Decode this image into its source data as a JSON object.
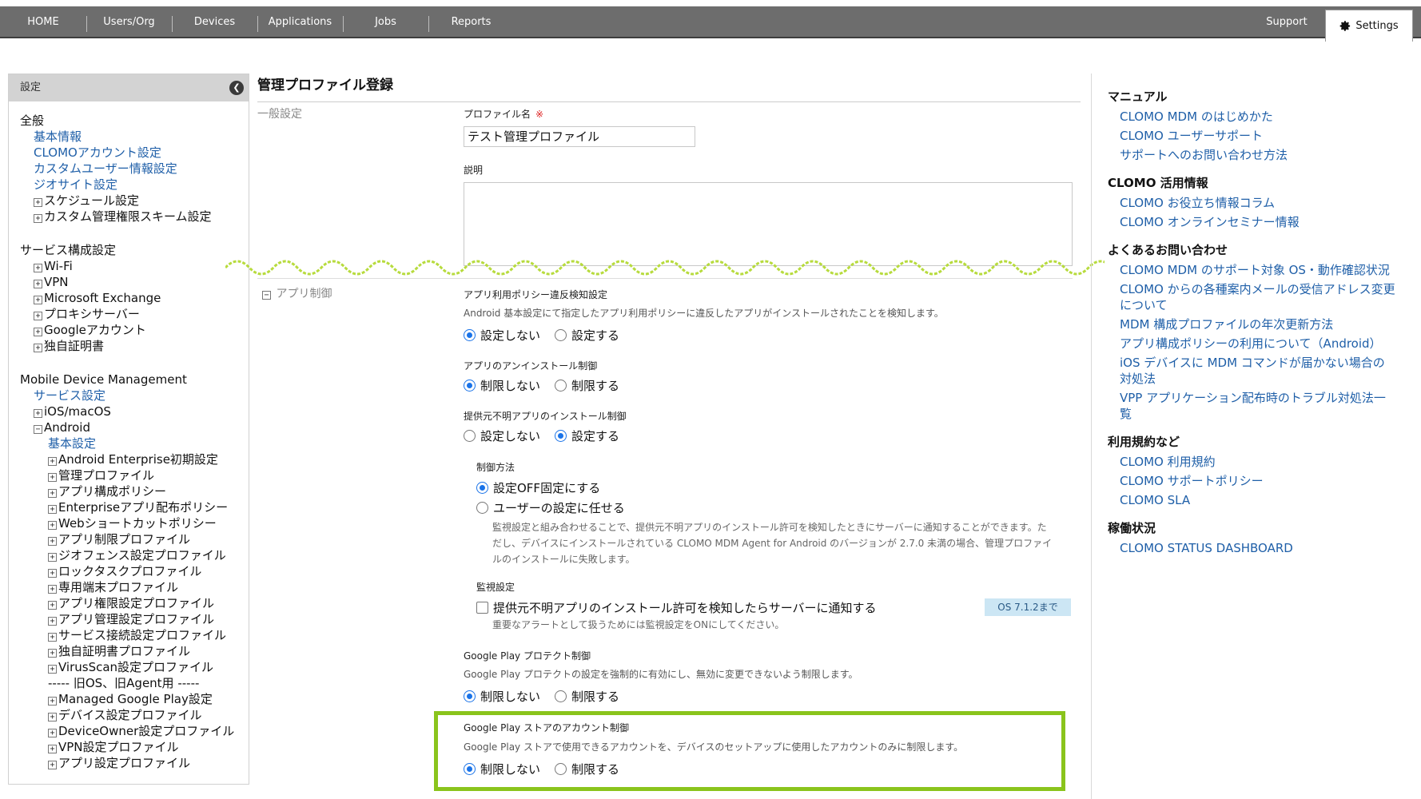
{
  "nav": {
    "items": [
      "HOME",
      "Users/Org",
      "Devices",
      "Applications",
      "Jobs",
      "Reports"
    ],
    "support": "Support",
    "settings": "Settings"
  },
  "sidebar": {
    "header": "設定",
    "collapse_glyph": "❮",
    "lines": [
      {
        "t": "全般",
        "k": "sec",
        "ind": 0
      },
      {
        "t": "基本情報",
        "k": "link",
        "ind": 1
      },
      {
        "t": "CLOMOアカウント設定",
        "k": "link",
        "ind": 1
      },
      {
        "t": "カスタムユーザー情報設定",
        "k": "link",
        "ind": 1
      },
      {
        "t": "ジオサイト設定",
        "k": "link",
        "ind": 1
      },
      {
        "t": "スケジュール設定",
        "k": "node",
        "ind": 1,
        "pm": "+"
      },
      {
        "t": "カスタム管理権限スキーム設定",
        "k": "node",
        "ind": 1,
        "pm": "+"
      },
      {
        "t": "サービス構成設定",
        "k": "sec",
        "ind": 0,
        "gap": true
      },
      {
        "t": "Wi-Fi",
        "k": "node",
        "ind": 1,
        "pm": "+"
      },
      {
        "t": "VPN",
        "k": "node",
        "ind": 1,
        "pm": "+"
      },
      {
        "t": "Microsoft Exchange",
        "k": "node",
        "ind": 1,
        "pm": "+"
      },
      {
        "t": "プロキシサーバー",
        "k": "node",
        "ind": 1,
        "pm": "+"
      },
      {
        "t": "Googleアカウント",
        "k": "node",
        "ind": 1,
        "pm": "+"
      },
      {
        "t": "独自証明書",
        "k": "node",
        "ind": 1,
        "pm": "+"
      },
      {
        "t": "Mobile Device Management",
        "k": "sec",
        "ind": 0,
        "gap": true
      },
      {
        "t": "サービス設定",
        "k": "link",
        "ind": 1
      },
      {
        "t": "iOS/macOS",
        "k": "node",
        "ind": 1,
        "pm": "+"
      },
      {
        "t": "Android",
        "k": "node",
        "ind": 1,
        "pm": "−"
      },
      {
        "t": "基本設定",
        "k": "link",
        "ind": 2
      },
      {
        "t": "Android Enterprise初期設定",
        "k": "node",
        "ind": 2,
        "pm": "+"
      },
      {
        "t": "管理プロファイル",
        "k": "node",
        "ind": 2,
        "pm": "+"
      },
      {
        "t": "アプリ構成ポリシー",
        "k": "node",
        "ind": 2,
        "pm": "+"
      },
      {
        "t": "Enterpriseアプリ配布ポリシー",
        "k": "node",
        "ind": 2,
        "pm": "+"
      },
      {
        "t": "Webショートカットポリシー",
        "k": "node",
        "ind": 2,
        "pm": "+"
      },
      {
        "t": "アプリ制限プロファイル",
        "k": "node",
        "ind": 2,
        "pm": "+"
      },
      {
        "t": "ジオフェンス設定プロファイル",
        "k": "node",
        "ind": 2,
        "pm": "+"
      },
      {
        "t": "ロックタスクプロファイル",
        "k": "node",
        "ind": 2,
        "pm": "+"
      },
      {
        "t": "専用端末プロファイル",
        "k": "node",
        "ind": 2,
        "pm": "+"
      },
      {
        "t": "アプリ権限設定プロファイル",
        "k": "node",
        "ind": 2,
        "pm": "+"
      },
      {
        "t": "アプリ管理設定プロファイル",
        "k": "node",
        "ind": 2,
        "pm": "+"
      },
      {
        "t": "サービス接続設定プロファイル",
        "k": "node",
        "ind": 2,
        "pm": "+"
      },
      {
        "t": "独自証明書プロファイル",
        "k": "node",
        "ind": 2,
        "pm": "+"
      },
      {
        "t": "VirusScan設定プロファイル",
        "k": "node",
        "ind": 2,
        "pm": "+"
      },
      {
        "t": "----- 旧OS、旧Agent用 -----",
        "k": "sec",
        "ind": 2
      },
      {
        "t": "Managed Google Play設定",
        "k": "node",
        "ind": 2,
        "pm": "+"
      },
      {
        "t": "デバイス設定プロファイル",
        "k": "node",
        "ind": 2,
        "pm": "+"
      },
      {
        "t": "DeviceOwner設定プロファイル",
        "k": "node",
        "ind": 2,
        "pm": "+"
      },
      {
        "t": "VPN設定プロファイル",
        "k": "node",
        "ind": 2,
        "pm": "+"
      },
      {
        "t": "アプリ設定プロファイル",
        "k": "node",
        "ind": 2,
        "pm": "+"
      }
    ]
  },
  "main": {
    "title": "管理プロファイル登録",
    "general_label": "一般設定",
    "profile_name_label": "プロファイル名",
    "required_mark": "※",
    "profile_name_value": "テスト管理プロファイル",
    "description_label": "説明",
    "app_control_label": "アプリ制御",
    "app_control_pm": "−",
    "policy_violation": {
      "title": "アプリ利用ポリシー違反検知設定",
      "desc": "Android 基本設定にて指定したアプリ利用ポリシーに違反したアプリがインストールされたことを検知します。",
      "opt1": "設定しない",
      "opt2": "設定する"
    },
    "uninstall": {
      "title": "アプリのアンインストール制御",
      "opt1": "制限しない",
      "opt2": "制限する"
    },
    "unknown_install": {
      "title": "提供元不明アプリのインストール制御",
      "opt1": "設定しない",
      "opt2": "設定する"
    },
    "control_method": {
      "title": "制御方法",
      "opt1": "設定OFF固定にする",
      "opt2": "ユーザーの設定に任せる",
      "note_line1": "監視設定と組み合わせることで、提供元不明アプリのインストール許可を検知したときにサーバーに通知することができます。た",
      "note_line2": "だし、デバイスにインストールされている CLOMO MDM Agent for Android のバージョンが 2.7.0 未満の場合、管理プロファイ",
      "note_line3": "ルのインストールに失敗します。"
    },
    "monitor": {
      "title": "監視設定",
      "checkbox": "提供元不明アプリのインストール許可を検知したらサーバーに通知する",
      "badge": "OS 7.1.2まで",
      "note": "重要なアラートとして扱うためには監視設定をONにしてください。"
    },
    "play_protect": {
      "title": "Google Play プロテクト制御",
      "desc": "Google Play プロテクトの設定を強制的に有効にし、無効に変更できないよう制限します。",
      "opt1": "制限しない",
      "opt2": "制限する"
    },
    "play_account": {
      "title": "Google Play ストアのアカウント制御",
      "desc": "Google Play ストアで使用できるアカウントを、デバイスのセットアップに使用したアカウントのみに制限します。",
      "opt1": "制限しない",
      "opt2": "制限する"
    }
  },
  "right": {
    "sections": [
      {
        "h": "マニュアル",
        "links": [
          "CLOMO MDM のはじめかた",
          "CLOMO ユーザーサポート",
          "サポートへのお問い合わせ方法"
        ]
      },
      {
        "h": "CLOMO 活用情報",
        "links": [
          "CLOMO お役立ち情報コラム",
          "CLOMO オンラインセミナー情報"
        ]
      },
      {
        "h": "よくあるお問い合わせ",
        "links": [
          "CLOMO MDM のサポート対象 OS・動作確認状況",
          "CLOMO からの各種案内メールの受信アドレス変更について",
          "MDM 構成プロファイルの年次更新方法",
          "アプリ構成ポリシーの利用について（Android）",
          "iOS デバイスに MDM コマンドが届かない場合の対処法",
          "VPP アプリケーション配布時のトラブル対処法一覧"
        ]
      },
      {
        "h": "利用規約など",
        "links": [
          "CLOMO 利用規約",
          "CLOMO サポートポリシー",
          "CLOMO SLA"
        ]
      },
      {
        "h": "稼働状況",
        "links": [
          "CLOMO STATUS DASHBOARD"
        ]
      }
    ]
  },
  "colors": {
    "nav_bg": "#6d6d6d",
    "link": "#1f5fa8",
    "highlight": "#8ac41c",
    "radio": "#1a73e8"
  }
}
